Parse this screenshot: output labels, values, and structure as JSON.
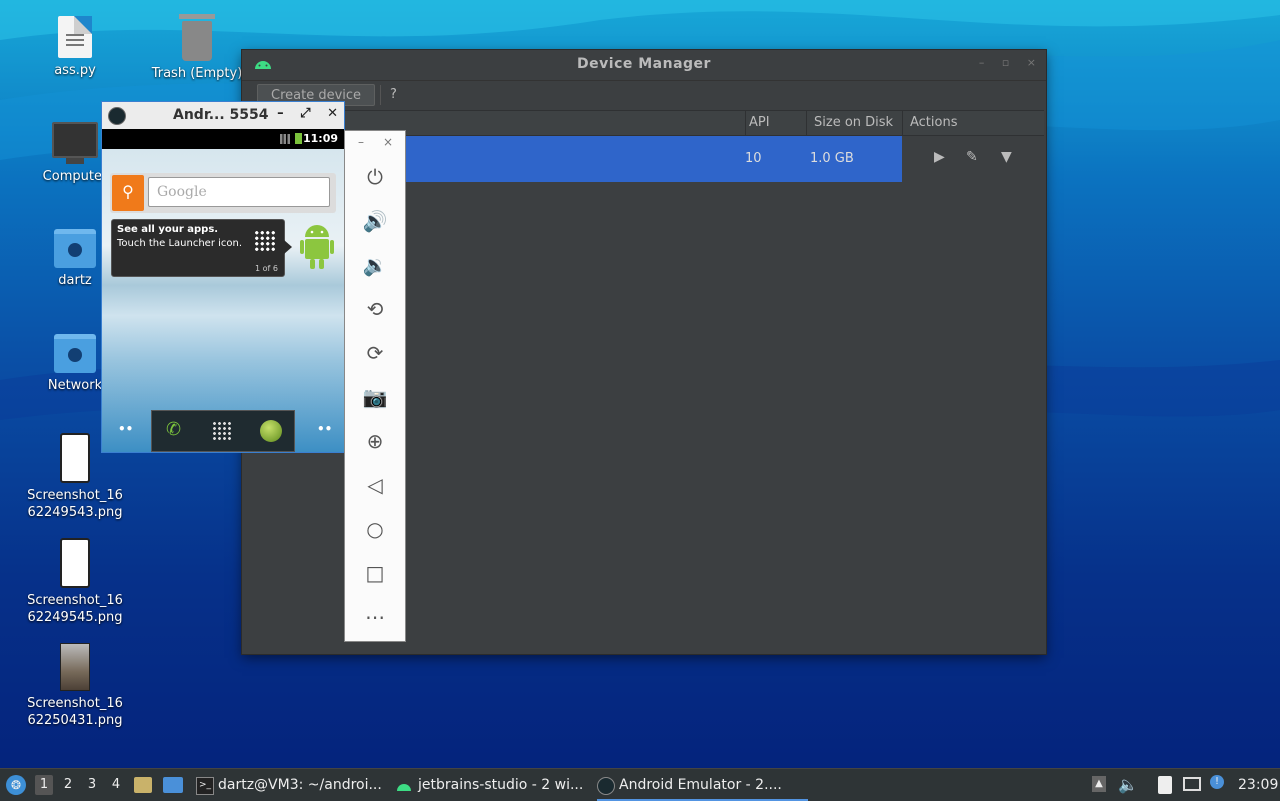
{
  "desktop": {
    "icons": [
      {
        "label": "ass.py"
      },
      {
        "label": "Trash (Empty)"
      },
      {
        "label": "Computer"
      },
      {
        "label": "dartz"
      },
      {
        "label": "Network"
      },
      {
        "label": "Screenshot_1662249543.png"
      },
      {
        "label": "Screenshot_1662249545.png"
      },
      {
        "label": "Screenshot_1662250431.png"
      }
    ]
  },
  "device_manager": {
    "title": "Device Manager",
    "create_label": "Create device",
    "help_label": "?",
    "columns": {
      "api": "API",
      "size": "Size on Disk",
      "actions": "Actions"
    },
    "row": {
      "api": "10",
      "size": "1.0 GB"
    },
    "window_controls": {
      "minimize": "–",
      "maximize": "▫",
      "close": "×"
    }
  },
  "emulator": {
    "title": "Andr... 5554",
    "controls": {
      "minimize": "–",
      "maximize": "⤢",
      "close": "✕"
    },
    "clock": "11:09",
    "search_placeholder": "Google",
    "tip_heading": "See all your apps.",
    "tip_body": "Touch the Launcher icon.",
    "tip_counter": "1 of 6"
  },
  "emulator_toolbar": {
    "minimize": "–",
    "close": "×",
    "buttons": [
      "power-icon",
      "volume-up-icon",
      "volume-down-icon",
      "rotate-left-icon",
      "rotate-right-icon",
      "camera-icon",
      "zoom-icon",
      "back-icon",
      "home-icon",
      "overview-icon",
      "more-icon"
    ]
  },
  "taskbar": {
    "workspaces": [
      "1",
      "2",
      "3",
      "4"
    ],
    "tasks": [
      {
        "label": "dartz@VM3: ~/androi..."
      },
      {
        "label": "jetbrains-studio - 2 wi..."
      },
      {
        "label": "Android Emulator - 2...."
      }
    ],
    "clock": "23:09"
  },
  "colors": {
    "selection": "#2f65ca",
    "window_bg": "#3c3f41",
    "taskbar_bg": "#2e3436",
    "accent": "#5294e2"
  }
}
